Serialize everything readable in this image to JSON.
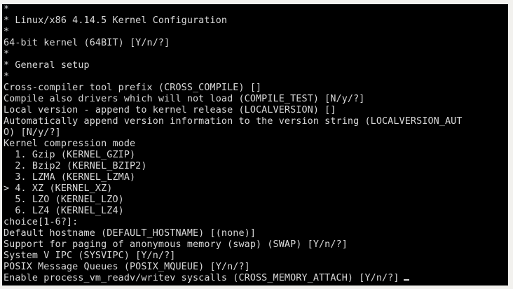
{
  "terminal": {
    "lines": [
      "*",
      "* Linux/x86 4.14.5 Kernel Configuration",
      "*",
      "64-bit kernel (64BIT) [Y/n/?]",
      "*",
      "* General setup",
      "*",
      "Cross-compiler tool prefix (CROSS_COMPILE) []",
      "Compile also drivers which will not load (COMPILE_TEST) [N/y/?]",
      "Local version - append to kernel release (LOCALVERSION) []",
      "Automatically append version information to the version string (LOCALVERSION_AUT",
      "O) [N/y/?]",
      "Kernel compression mode",
      "  1. Gzip (KERNEL_GZIP)",
      "  2. Bzip2 (KERNEL_BZIP2)",
      "  3. LZMA (KERNEL_LZMA)",
      "> 4. XZ (KERNEL_XZ)",
      "  5. LZO (KERNEL_LZO)",
      "  6. LZ4 (KERNEL_LZ4)",
      "choice[1-6?]:",
      "Default hostname (DEFAULT_HOSTNAME) [(none)]",
      "Support for paging of anonymous memory (swap) (SWAP) [Y/n/?]",
      "System V IPC (SYSVIPC) [Y/n/?]",
      "POSIX Message Queues (POSIX_MQUEUE) [Y/n/?]"
    ],
    "prompt_line": "Enable process_vm_readv/writev syscalls (CROSS_MEMORY_ATTACH) [Y/n/?]"
  }
}
